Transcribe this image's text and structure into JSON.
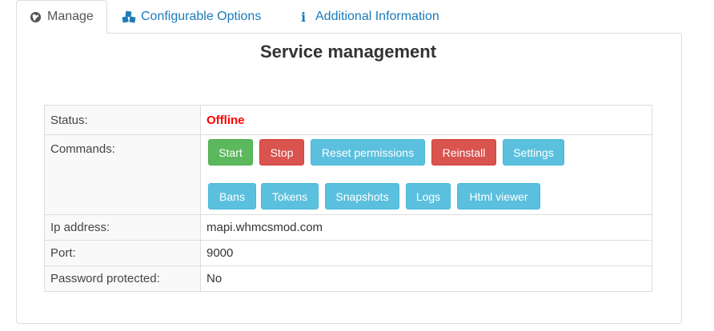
{
  "tabs": [
    {
      "label": "Manage",
      "icon": "globe-icon"
    },
    {
      "label": "Configurable Options",
      "icon": "cubes-icon"
    },
    {
      "label": "Additional Information",
      "icon": "info-icon"
    }
  ],
  "title": "Service management",
  "rows": {
    "status": {
      "label": "Status:",
      "value": "Offline"
    },
    "commands": {
      "label": "Commands:"
    },
    "ip": {
      "label": "Ip address:",
      "value": "mapi.whmcsmod.com"
    },
    "port": {
      "label": "Port:",
      "value": "9000"
    },
    "password": {
      "label": "Password protected:",
      "value": "No"
    }
  },
  "buttons": {
    "start": "Start",
    "stop": "Stop",
    "reset_permissions": "Reset permissions",
    "reinstall": "Reinstall",
    "settings": "Settings",
    "bans": "Bans",
    "tokens": "Tokens",
    "snapshots": "Snapshots",
    "logs": "Logs",
    "html_viewer": "Html viewer"
  },
  "colors": {
    "accent": "#1a7bb9",
    "success": "#5cb85c",
    "danger": "#d9534f",
    "info": "#5bc0de",
    "offline": "#ff0000"
  }
}
